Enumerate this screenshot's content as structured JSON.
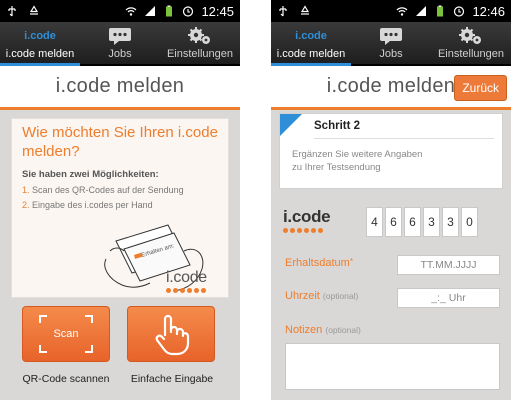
{
  "status_bar": {
    "left": {
      "time": "12:45",
      "icons": [
        "usb-icon",
        "recycle-icon",
        "wifi-icon",
        "signal-icon",
        "battery-icon",
        "alarm-icon"
      ]
    },
    "right": {
      "time": "12:46",
      "icons": [
        "usb-icon",
        "recycle-icon",
        "wifi-icon",
        "signal-icon",
        "battery-icon",
        "alarm-icon"
      ]
    }
  },
  "tabs": [
    {
      "label": "i.code melden",
      "icon": "icode-logo-icon",
      "active": true
    },
    {
      "label": "Jobs",
      "icon": "chat-bubble-icon",
      "active": false
    },
    {
      "label": "Einstellungen",
      "icon": "gears-icon",
      "active": false
    }
  ],
  "tab_logo_text": "i.code",
  "left": {
    "header_title": "i.code melden",
    "question": "Wie möchten Sie Ihren i.code melden?",
    "subtitle": "Sie haben zwei Möglichkeiten:",
    "options": [
      {
        "num": "1.",
        "text": "Scan des QR-Codes auf der Sendung"
      },
      {
        "num": "2.",
        "text": "Eingabe des i.codes per Hand"
      }
    ],
    "card_image_text": "Erhalten am:",
    "logo_text": "i.code",
    "scan_button_text": "Scan",
    "scan_label": "QR-Code scannen",
    "manual_label": "Einfache Eingabe"
  },
  "right": {
    "header_title": "i.code melden",
    "back_button": "Zurück",
    "step_title": "Schritt 2",
    "step_desc_line1": "Ergänzen Sie weitere Angaben",
    "step_desc_line2": "zu Ihrer Testsendung",
    "logo_text": "i.code",
    "code_digits": [
      "4",
      "6",
      "6",
      "3",
      "3",
      "0"
    ],
    "date_label": "Erhaltsdatum",
    "date_required_mark": "*",
    "date_placeholder": "TT.MM.JJJJ",
    "time_label": "Uhrzeit",
    "time_optional": "(optional)",
    "time_placeholder": "_:_ Uhr",
    "notes_label": "Notizen",
    "notes_optional": "(optional)",
    "notes_value": ""
  },
  "colors": {
    "accent": "#ee7d2c",
    "tab_highlight": "#2e8fd8",
    "background": "#d9d8d6"
  }
}
